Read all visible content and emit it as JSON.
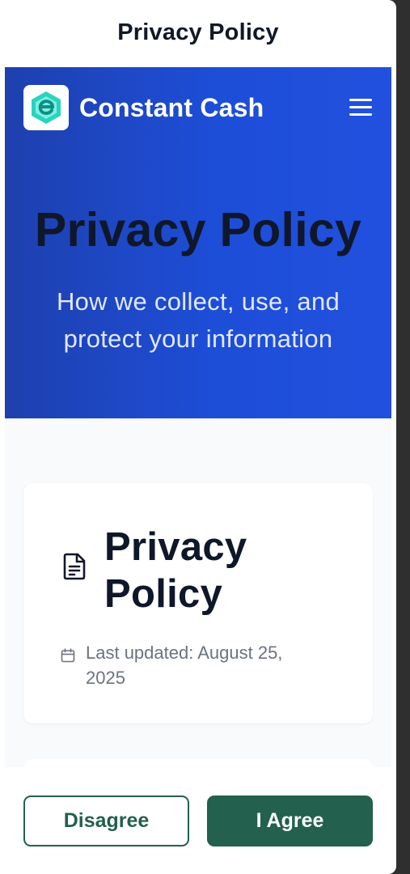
{
  "dialog": {
    "title": "Privacy Policy"
  },
  "navbar": {
    "brand": "Constant Cash",
    "logo_icon": "constant-cash-logo",
    "menu_icon": "hamburger-menu-icon"
  },
  "hero": {
    "title": "Privacy Policy",
    "subtitle": "How we collect, use, and protect your information"
  },
  "card": {
    "title": "Privacy Policy",
    "icon": "document-icon",
    "updated_icon": "calendar-icon",
    "updated_text": "Last updated: August 25, 2025"
  },
  "footer": {
    "disagree_label": "Disagree",
    "agree_label": "I Agree"
  },
  "colors": {
    "hero_start": "#1e40af",
    "hero_end": "#2150de",
    "accent_green": "#23604e",
    "logo_teal": "#2ad3c0"
  }
}
